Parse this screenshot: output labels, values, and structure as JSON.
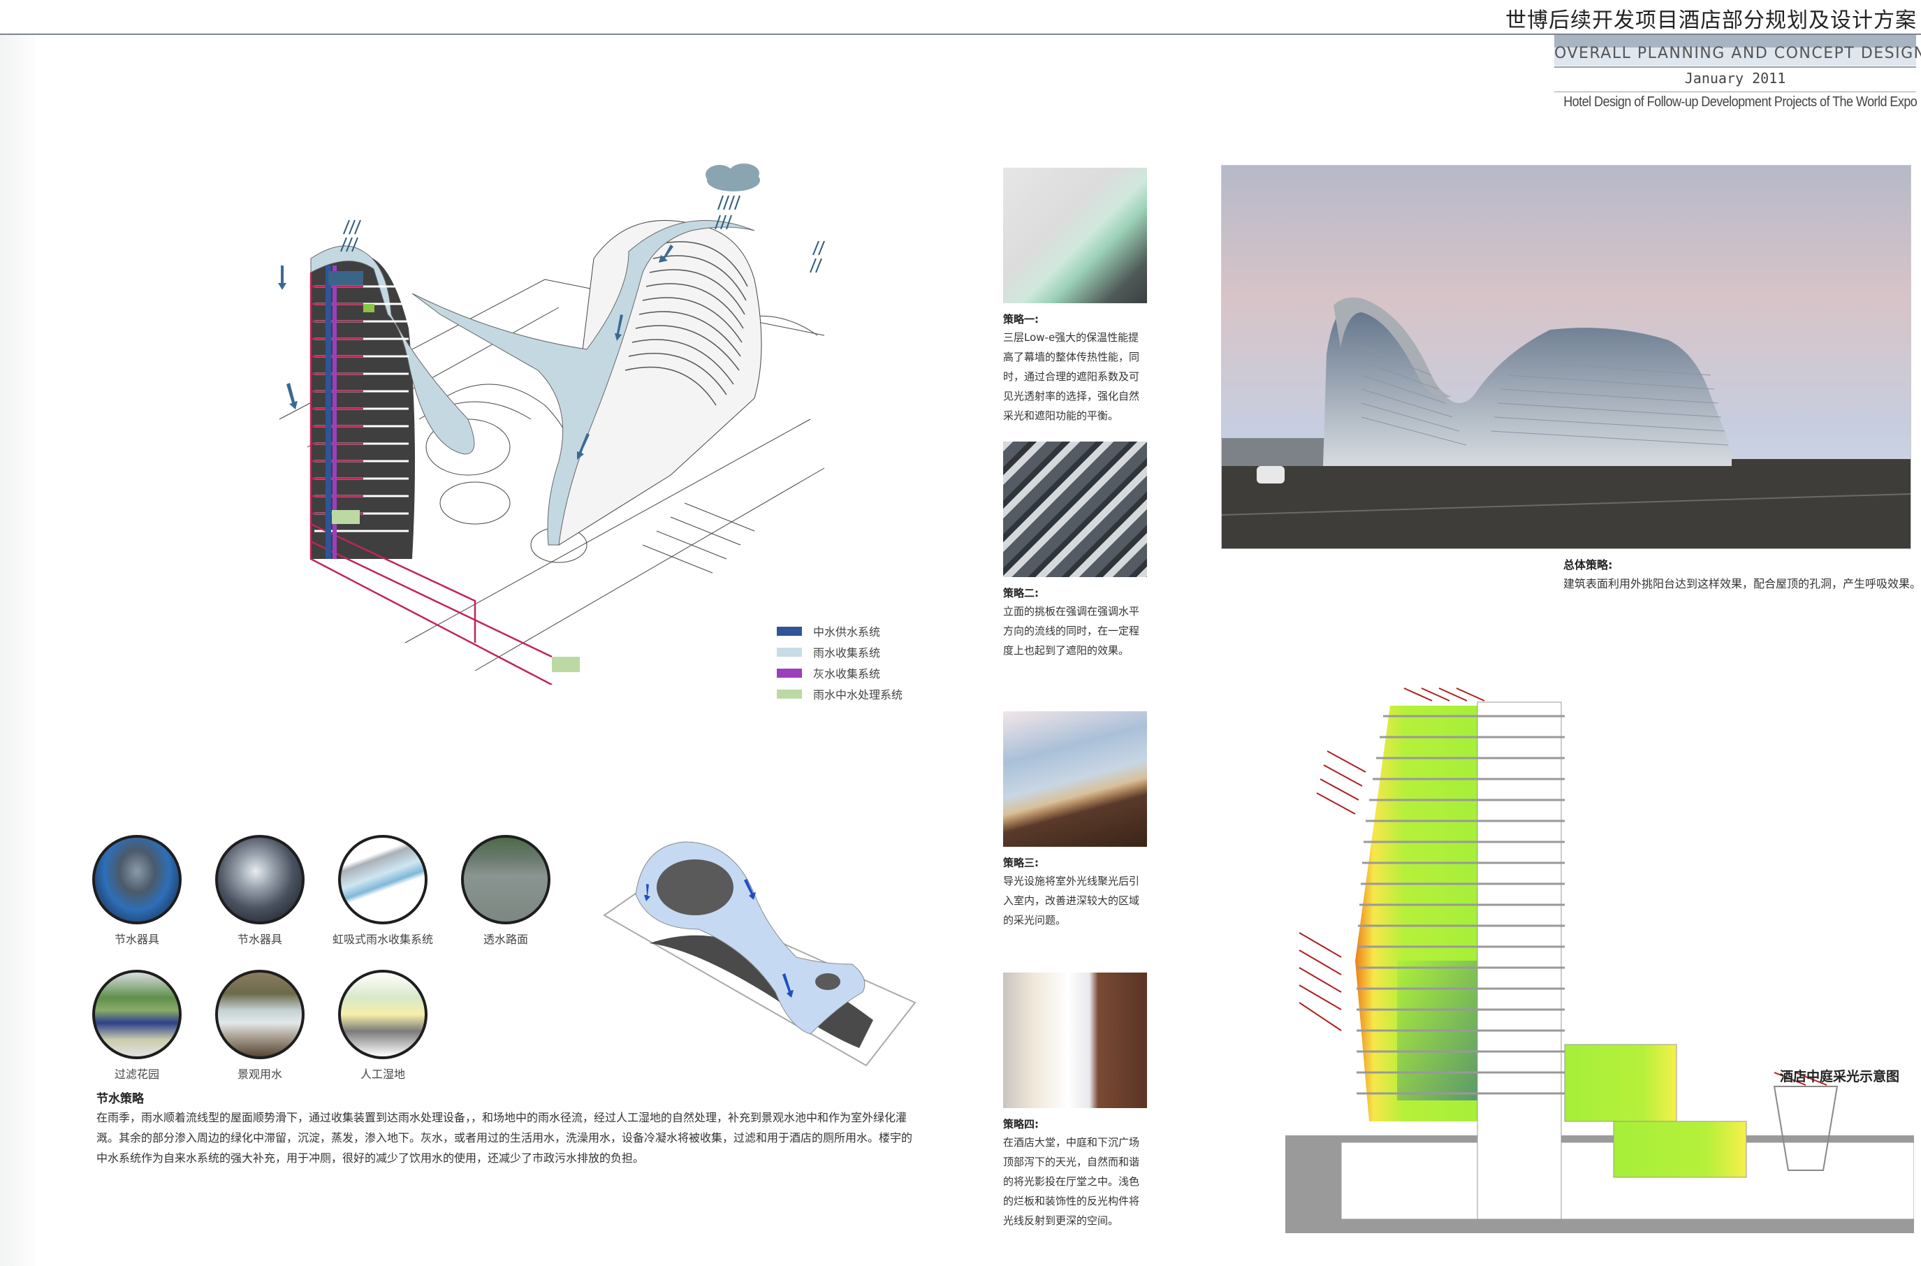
{
  "header": {
    "title_cn": "世博后续开发项目酒店部分规划及设计方案",
    "title_en": "OVERALL PLANNING AND CONCEPT DESIGN",
    "date": "January 2011",
    "subtitle": "Hotel Design of Follow-up Development Projects of The World Expo"
  },
  "water_diagram": {
    "legend": [
      {
        "label": "中水供水系统",
        "color": "#2f5597"
      },
      {
        "label": "雨水收集系统",
        "color": "#c9dce6"
      },
      {
        "label": "灰水收集系统",
        "color": "#9b3fbf"
      },
      {
        "label": "雨水中水处理系统",
        "color": "#bcd9a3"
      }
    ]
  },
  "water_saving": {
    "items": [
      {
        "label": "节水器具",
        "icon": "urinal-icon"
      },
      {
        "label": "节水器具",
        "icon": "flush-valve-icon"
      },
      {
        "label": "虹吸式雨水收集系统",
        "icon": "siphon-drain-icon"
      },
      {
        "label": "透水路面",
        "icon": "permeable-pavement-icon"
      },
      {
        "label": "过滤花园",
        "icon": "filter-garden-icon"
      },
      {
        "label": "景观用水",
        "icon": "landscape-water-icon"
      },
      {
        "label": "人工湿地",
        "icon": "wetland-icon"
      }
    ],
    "title": "节水策略",
    "text": "在雨季，雨水顺着流线型的屋面顺势滑下，通过收集装置到达雨水处理设备，，和场地中的雨水径流，经过人工湿地的自然处理，补充到景观水池中和作为室外绿化灌溉。其余的部分渗入周边的绿化中滞留，沉淀，蒸发，渗入地下。灰水，或者用过的生活用水，洗澡用水，设备冷凝水将被收集，过滤和用于酒店的厕所用水。楼宇的中水系统作为自来水系统的强大补充，用于冲厕，很好的减少了饮用水的使用，还减少了市政污水排放的负担。"
  },
  "strategies": [
    {
      "title": "策略一:",
      "text": "三层Low-e强大的保温性能提高了幕墙的整体传热性能，同时，通过合理的遮阳系数及可见光透射率的选择，强化自然采光和遮阳功能的平衡。",
      "image": "low-e-window-section"
    },
    {
      "title": "策略二:",
      "text": "立面的挑板在强调在强调水平方向的流线的同时，在一定程度上也起到了遮阳的效果。",
      "image": "facade-louvers"
    },
    {
      "title": "策略三:",
      "text": "导光设施将室外光线聚光后引入室内，改善进深较大的区域的采光问题。",
      "image": "light-tube"
    },
    {
      "title": "策略四:",
      "text": "在酒店大堂，中庭和下沉广场顶部泻下的天光，自然而和谐的将光影投在厅堂之中。浅色的烂板和装饰性的反光构件将光线反射到更深的空间。",
      "image": "atrium-skylight"
    }
  ],
  "overall": {
    "title": "总体策略:",
    "text": "建筑表面利用外挑阳台达到这样效果，配合屋顶的孔洞，产生呼吸效果。"
  },
  "section": {
    "caption": "酒店中庭采光示意图"
  }
}
